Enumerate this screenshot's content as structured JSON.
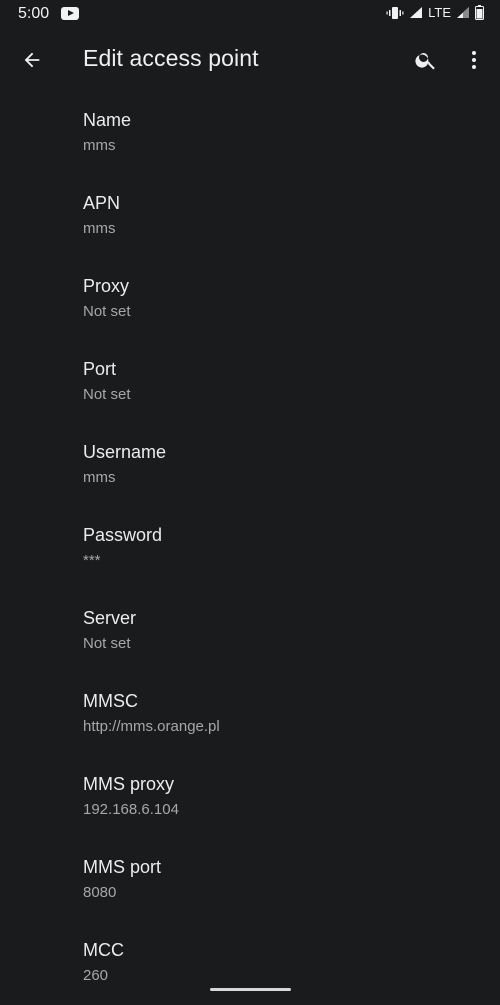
{
  "status_bar": {
    "time": "5:00",
    "network": "LTE"
  },
  "toolbar": {
    "title": "Edit access point",
    "icons": [
      "back-arrow-icon",
      "search-icon",
      "more-vert-icon"
    ]
  },
  "settings": [
    {
      "title": "Name",
      "value": "mms"
    },
    {
      "title": "APN",
      "value": "mms"
    },
    {
      "title": "Proxy",
      "value": "Not set"
    },
    {
      "title": "Port",
      "value": "Not set"
    },
    {
      "title": "Username",
      "value": "mms"
    },
    {
      "title": "Password",
      "value": "***"
    },
    {
      "title": "Server",
      "value": "Not set"
    },
    {
      "title": "MMSC",
      "value": "http://mms.orange.pl"
    },
    {
      "title": "MMS proxy",
      "value": "192.168.6.104"
    },
    {
      "title": "MMS port",
      "value": "8080"
    },
    {
      "title": "MCC",
      "value": "260"
    }
  ],
  "colors": {
    "background": "#1a1b1d",
    "text_primary": "#ececec",
    "text_secondary": "#a7a7a7"
  }
}
